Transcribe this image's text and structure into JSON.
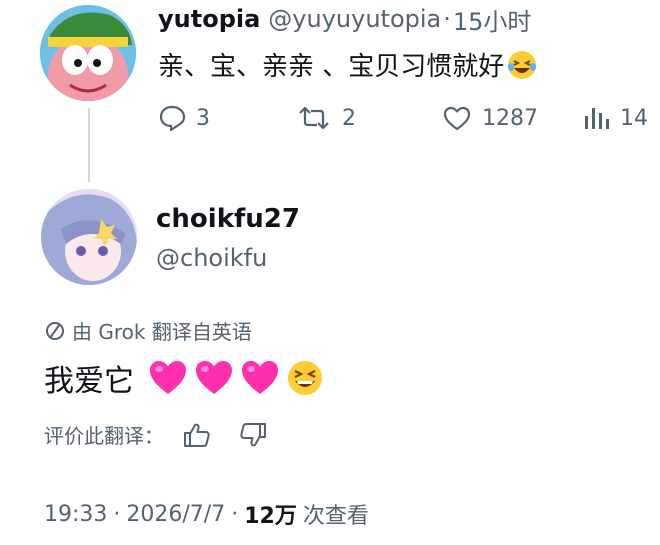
{
  "parent_post": {
    "display_name": "yutopia",
    "handle": "@yuyuyutopia",
    "separator": "·",
    "time": "15小时",
    "text": "亲、宝、亲亲 、宝贝习惯就好",
    "text_emoji": "laughing-tears-emoji",
    "actions": {
      "replies": "3",
      "reposts": "2",
      "likes": "1287",
      "views": "14"
    }
  },
  "reply": {
    "display_name": "choikfu27",
    "handle": "@choikfu",
    "translation_note": "由 Grok 翻译自英语",
    "text": "我爱它",
    "rate_label": "评价此翻译：",
    "meta": {
      "time": "19:33",
      "dot1": "·",
      "date": "2026/7/7",
      "dot2": "·",
      "views_count": "12万",
      "views_label": "次查看"
    }
  },
  "colors": {
    "text": "#0f1419",
    "muted": "#536471",
    "thread_line": "#cfd9de",
    "heart": "#ff2fae"
  }
}
